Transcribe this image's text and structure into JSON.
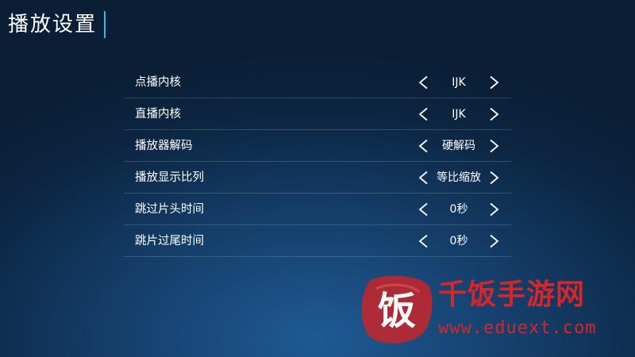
{
  "header": {
    "title": "播放设置"
  },
  "settings": [
    {
      "label": "点播内核",
      "value": "IJK"
    },
    {
      "label": "直播内核",
      "value": "IJK"
    },
    {
      "label": "播放器解码",
      "value": "硬解码"
    },
    {
      "label": "播放显示比列",
      "value": "等比缩放"
    },
    {
      "label": "跳过片头时间",
      "value": "0秒"
    },
    {
      "label": "跳片过尾时间",
      "value": "0秒"
    }
  ],
  "icons": {
    "previous": "chevron-left-icon",
    "next": "chevron-right-icon"
  },
  "watermark": {
    "logo_char": "饭",
    "brand": "千饭手游网",
    "url": "www.eduext.com"
  },
  "colors": {
    "accent": "#3fb6e6",
    "watermark": "#d6262a"
  }
}
